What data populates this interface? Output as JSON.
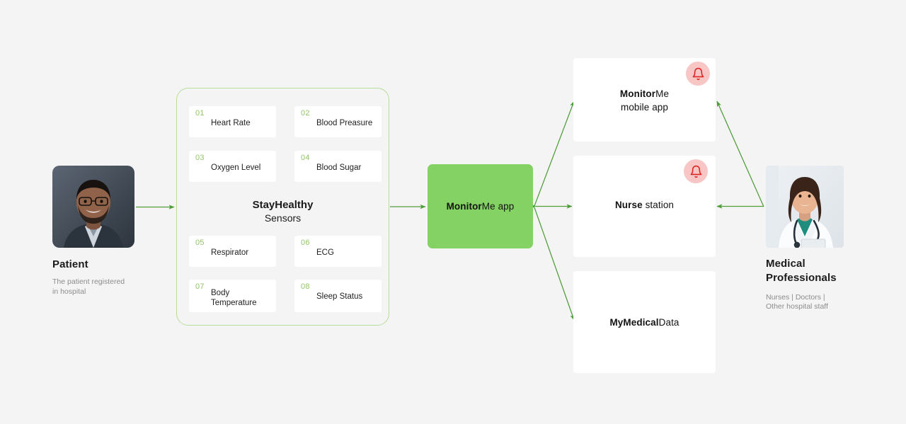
{
  "page": {
    "background": "#f4f4f4",
    "accent_green": "#84d263",
    "arrow_green": "#4f9c3a",
    "panel_border_green": "#b6dd9a",
    "number_green": "#93c46a",
    "bell_circle": "#f9c6c6",
    "bell_red": "#e02424"
  },
  "patient": {
    "title": "Patient",
    "description": "The patient registered\nin hospital",
    "photo_alt": "smiling-man-with-glasses-photo"
  },
  "sensors_panel": {
    "heading_bold": "StayHealthy",
    "heading_regular": "Sensors",
    "items": [
      {
        "num": "01",
        "label": "Heart Rate"
      },
      {
        "num": "02",
        "label": "Blood Preasure"
      },
      {
        "num": "03",
        "label": "Oxygen Level"
      },
      {
        "num": "04",
        "label": "Blood Sugar"
      },
      {
        "num": "05",
        "label": "Respirator"
      },
      {
        "num": "06",
        "label": "ECG"
      },
      {
        "num": "07",
        "label": "Body Temperature"
      },
      {
        "num": "08",
        "label": "Sleep Status"
      }
    ]
  },
  "central_node": {
    "label_bold": "Monitor",
    "label_regular": "Me app"
  },
  "destinations": [
    {
      "label_bold": "Monitor",
      "label_regular": "Me",
      "label_line2": "mobile app",
      "has_bell": true,
      "bell_icon": "bell-icon"
    },
    {
      "label_bold": "Nurse",
      "label_regular": " station",
      "label_line2": "",
      "has_bell": true,
      "bell_icon": "bell-icon"
    },
    {
      "label_bold": "MyMedical",
      "label_regular": "Data",
      "label_line2": "",
      "has_bell": false,
      "bell_icon": ""
    }
  ],
  "medical_professionals": {
    "title": "Medical\nProfessionals",
    "description": "Nurses | Doctors |\nOther hospital staff",
    "photo_alt": "female-doctor-in-white-coat-photo"
  }
}
